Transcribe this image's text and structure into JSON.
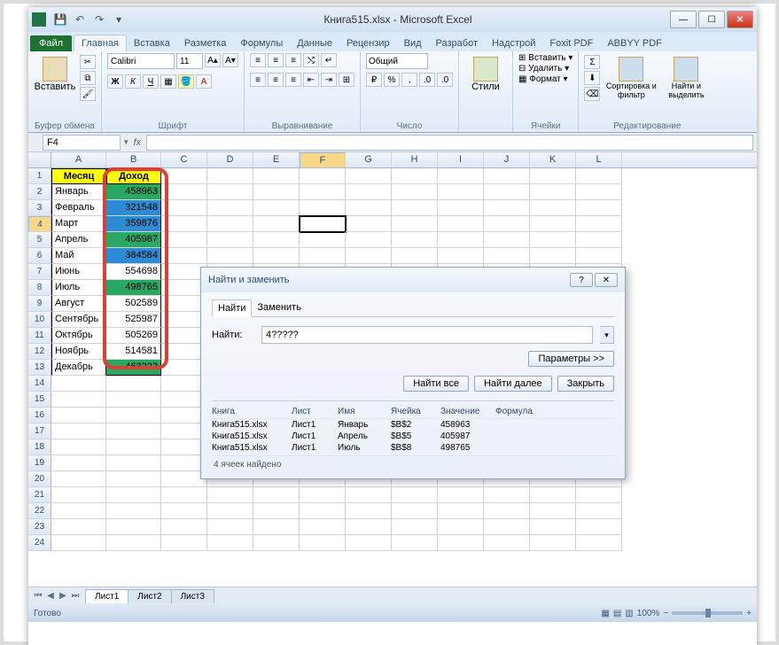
{
  "title": "Книга515.xlsx - Microsoft Excel",
  "tabs": {
    "file": "Файл",
    "list": [
      "Главная",
      "Вставка",
      "Разметка",
      "Формулы",
      "Данные",
      "Рецензир",
      "Вид",
      "Разработ",
      "Надстрой",
      "Foxit PDF",
      "ABBYY PDF"
    ],
    "active": 0
  },
  "ribbon": {
    "clipboard": {
      "paste": "Вставить",
      "label": "Буфер обмена"
    },
    "font": {
      "name": "Calibri",
      "size": "11",
      "label": "Шрифт"
    },
    "align": {
      "label": "Выравнивание"
    },
    "number": {
      "format": "Общий",
      "label": "Число"
    },
    "styles": {
      "btn": "Стили",
      "label": ""
    },
    "cells": {
      "insert": "Вставить",
      "delete": "Удалить",
      "format": "Формат",
      "label": "Ячейки"
    },
    "editing": {
      "sort": "Сортировка и фильтр",
      "find": "Найти и выделить",
      "label": "Редактирование"
    }
  },
  "name_box": "F4",
  "fx": "fx",
  "columns": [
    "A",
    "B",
    "C",
    "D",
    "E",
    "F",
    "G",
    "H",
    "I",
    "J",
    "K",
    "L"
  ],
  "headers": {
    "A1": "Месяц",
    "B1": "Доход"
  },
  "rows": [
    {
      "n": 1
    },
    {
      "n": 2,
      "m": "Январь",
      "v": "458963",
      "bg": "#28a862",
      "fg": "#0b4"
    },
    {
      "n": 3,
      "m": "Февраль",
      "v": "321548",
      "bg": "#2b8bd4"
    },
    {
      "n": 4,
      "m": "Март",
      "v": "359876",
      "bg": "#2b8bd4"
    },
    {
      "n": 5,
      "m": "Апрель",
      "v": "405987",
      "bg": "#28a862",
      "fg": "#0b4"
    },
    {
      "n": 6,
      "m": "Май",
      "v": "384584",
      "bg": "#2b8bd4"
    },
    {
      "n": 7,
      "m": "Июнь",
      "v": "554698",
      "bg": ""
    },
    {
      "n": 8,
      "m": "Июль",
      "v": "498765",
      "bg": "#28a862",
      "fg": "#0b4"
    },
    {
      "n": 9,
      "m": "Август",
      "v": "502589",
      "bg": ""
    },
    {
      "n": 10,
      "m": "Сентябрь",
      "v": "525987",
      "bg": ""
    },
    {
      "n": 11,
      "m": "Октябрь",
      "v": "505269",
      "bg": ""
    },
    {
      "n": 12,
      "m": "Ноябрь",
      "v": "514581",
      "bg": ""
    },
    {
      "n": 13,
      "m": "Декабрь",
      "v": "463222",
      "bg": "#28a862",
      "fg": "#0b4"
    }
  ],
  "sheets": [
    "Лист1",
    "Лист2",
    "Лист3"
  ],
  "status": {
    "ready": "Готово",
    "zoom": "100%"
  },
  "dialog": {
    "title": "Найти и заменить",
    "tab_find": "Найти",
    "tab_replace": "Заменить",
    "find_label": "Найти:",
    "find_value": "4?????",
    "params": "Параметры >>",
    "find_all": "Найти все",
    "find_next": "Найти далее",
    "close": "Закрыть",
    "cols": {
      "book": "Книга",
      "sheet": "Лист",
      "name": "Имя",
      "cell": "Ячейка",
      "value": "Значение",
      "formula": "Формула"
    },
    "results": [
      {
        "book": "Книга515.xlsx",
        "sheet": "Лист1",
        "name": "Январь",
        "cell": "$B$2",
        "value": "458963"
      },
      {
        "book": "Книга515.xlsx",
        "sheet": "Лист1",
        "name": "Апрель",
        "cell": "$B$5",
        "value": "405987"
      },
      {
        "book": "Книга515.xlsx",
        "sheet": "Лист1",
        "name": "Июль",
        "cell": "$B$8",
        "value": "498765"
      }
    ],
    "status": "4 ячеек найдено"
  }
}
